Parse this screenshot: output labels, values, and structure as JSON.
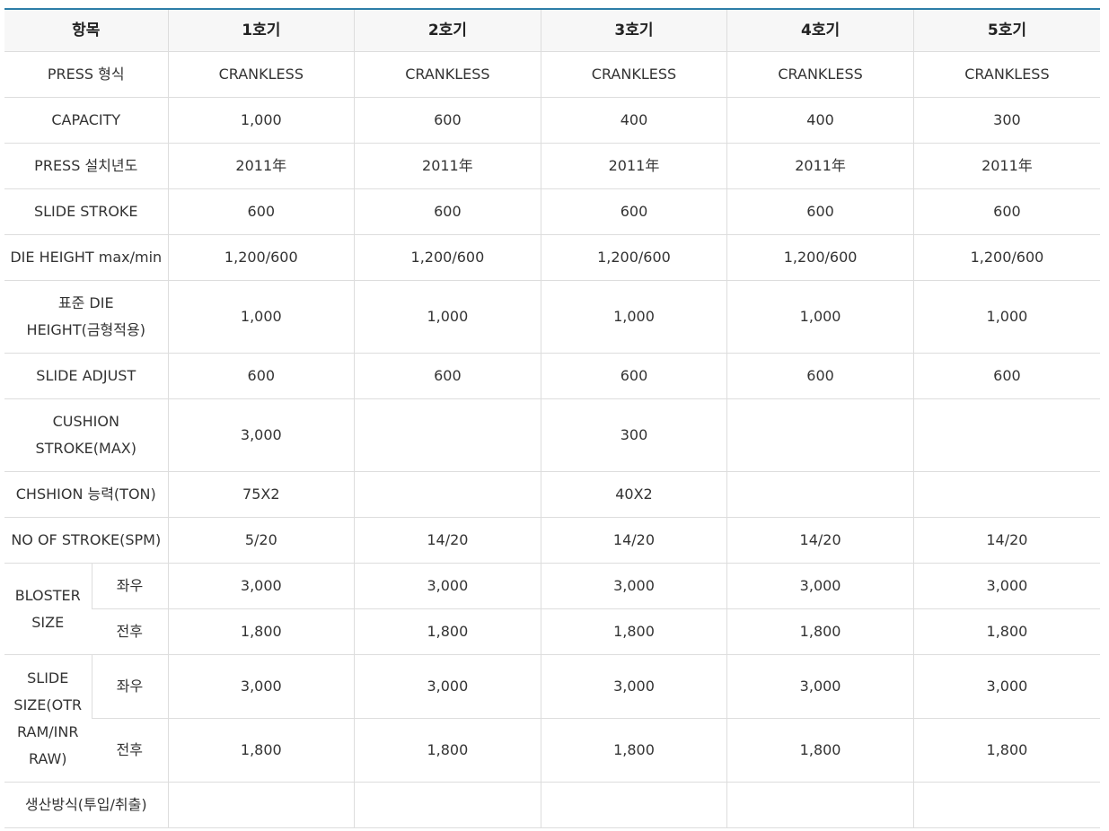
{
  "header": {
    "item": "항목",
    "units": [
      "1호기",
      "2호기",
      "3호기",
      "4호기",
      "5호기"
    ]
  },
  "rows": {
    "press_type": {
      "label": "PRESS 형식",
      "values": [
        "CRANKLESS",
        "CRANKLESS",
        "CRANKLESS",
        "CRANKLESS",
        "CRANKLESS"
      ]
    },
    "capacity": {
      "label": "CAPACITY",
      "values": [
        "1,000",
        "600",
        "400",
        "400",
        "300"
      ]
    },
    "install_year": {
      "label": "PRESS 설치년도",
      "values": [
        "2011年",
        "2011年",
        "2011年",
        "2011年",
        "2011年"
      ]
    },
    "slide_stroke": {
      "label": "SLIDE STROKE",
      "values": [
        "600",
        "600",
        "600",
        "600",
        "600"
      ]
    },
    "die_height": {
      "label": "DIE HEIGHT max/min",
      "values": [
        "1,200/600",
        "1,200/600",
        "1,200/600",
        "1,200/600",
        "1,200/600"
      ]
    },
    "std_die_height": {
      "label_line1": "표준 DIE",
      "label_line2": "HEIGHT(금형적용)",
      "values": [
        "1,000",
        "1,000",
        "1,000",
        "1,000",
        "1,000"
      ]
    },
    "slide_adjust": {
      "label": "SLIDE ADJUST",
      "values": [
        "600",
        "600",
        "600",
        "600",
        "600"
      ]
    },
    "cushion_stroke": {
      "label_line1": "CUSHION",
      "label_line2": "STROKE(MAX)",
      "values": [
        "3,000",
        "",
        "300",
        "",
        ""
      ]
    },
    "cushion_capacity": {
      "label": "CHSHION 능력(TON)",
      "values": [
        "75X2",
        "",
        "40X2",
        "",
        ""
      ]
    },
    "no_of_stroke": {
      "label": "NO OF STROKE(SPM)",
      "values": [
        "5/20",
        "14/20",
        "14/20",
        "14/20",
        "14/20"
      ]
    },
    "bolster_size": {
      "label_line1": "BLOSTER",
      "label_line2": "SIZE",
      "lr": {
        "label": "좌우",
        "values": [
          "3,000",
          "3,000",
          "3,000",
          "3,000",
          "3,000"
        ]
      },
      "fb": {
        "label": "전후",
        "values": [
          "1,800",
          "1,800",
          "1,800",
          "1,800",
          "1,800"
        ]
      }
    },
    "slide_size": {
      "label_line1": "SLIDE",
      "label_line2": "SIZE(OTR",
      "label_line3": "RAM/INR",
      "label_line4": "RAW)",
      "lr": {
        "label": "좌우",
        "values": [
          "3,000",
          "3,000",
          "3,000",
          "3,000",
          "3,000"
        ]
      },
      "fb": {
        "label": "전후",
        "values": [
          "1,800",
          "1,800",
          "1,800",
          "1,800",
          "1,800"
        ]
      }
    },
    "production_method": {
      "label": "생산방식(투입/취출)",
      "values": [
        "",
        "",
        "",
        "",
        ""
      ]
    }
  }
}
